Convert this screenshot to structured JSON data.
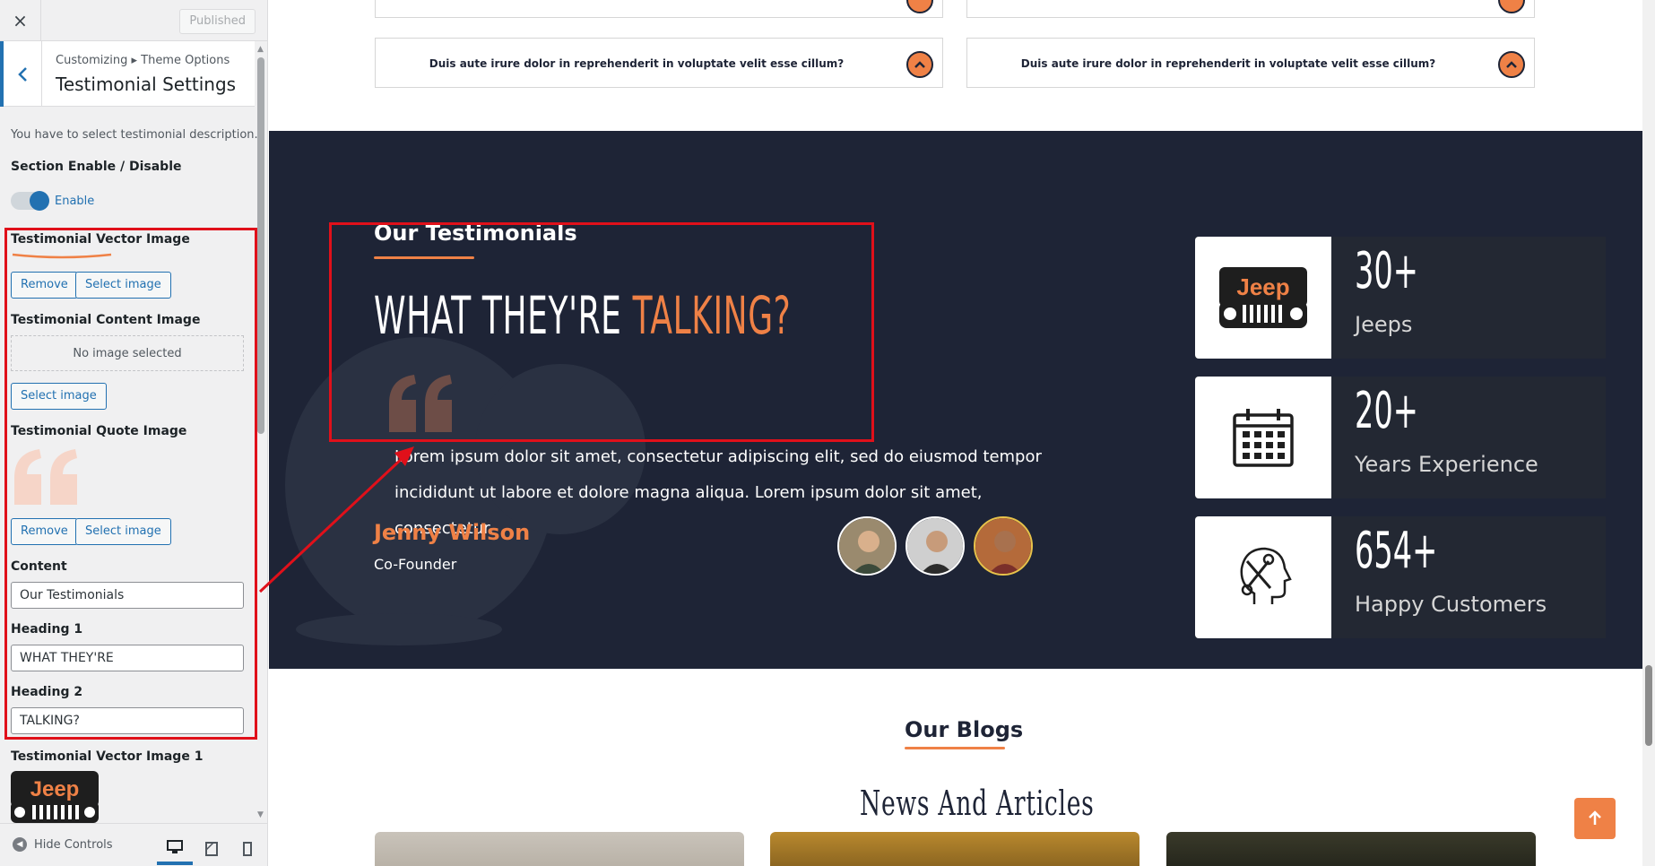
{
  "customizer": {
    "close_icon": "×",
    "published_label": "Published",
    "breadcrumb": "Customizing ▸ Theme Options",
    "section_title": "Testimonial Settings",
    "description": "You have to select testimonial description.",
    "section_toggle_label": "Section Enable / Disable",
    "toggle_state_label": "Enable",
    "vector_image_label": "Testimonial Vector Image",
    "remove_label": "Remove",
    "select_image_label": "Select image",
    "content_image_label": "Testimonial Content Image",
    "no_image_label": "No image selected",
    "quote_image_label": "Testimonial Quote Image",
    "content_label": "Content",
    "content_value": "Our Testimonials",
    "heading1_label": "Heading 1",
    "heading1_value": "WHAT THEY'RE",
    "heading2_label": "Heading 2",
    "heading2_value": "TALKING?",
    "vector_image1_label": "Testimonial Vector Image 1",
    "jeep_logo_text": "Jeep",
    "hide_controls_label": "Hide Controls"
  },
  "preview": {
    "faq": [
      {
        "question": "Duis aute irure dolor in reprehenderit in voluptate velit esse cillum?"
      },
      {
        "question": "Duis aute irure dolor in reprehenderit in voluptate velit esse cillum?"
      }
    ],
    "testimonials": {
      "subtitle": "Our Testimonials",
      "heading_white": "WHAT THEY'RE",
      "heading_orange": "TALKING?",
      "text": "Lorem ipsum dolor sit amet, consectetur adipiscing elit, sed do eiusmod tempor incididunt ut labore et dolore magna aliqua. Lorem ipsum dolor sit amet, consectetur.",
      "name": "Jenny Wilson",
      "role": "Co-Founder"
    },
    "stats": [
      {
        "number": "30+",
        "label": "Jeeps",
        "icon": "jeep-logo-icon"
      },
      {
        "number": "20+",
        "label": "Years Experience",
        "icon": "calendar-icon"
      },
      {
        "number": "654+",
        "label": "Happy Customers",
        "icon": "mechanic-head-icon"
      }
    ],
    "jeep_logo_text": "Jeep",
    "blogs": {
      "subtitle": "Our Blogs",
      "heading": "News And Articles"
    }
  },
  "colors": {
    "accent": "#ef8146",
    "dark_bg": "#1e2436",
    "wp_blue": "#2271b1",
    "highlight_red": "#e0101a"
  }
}
